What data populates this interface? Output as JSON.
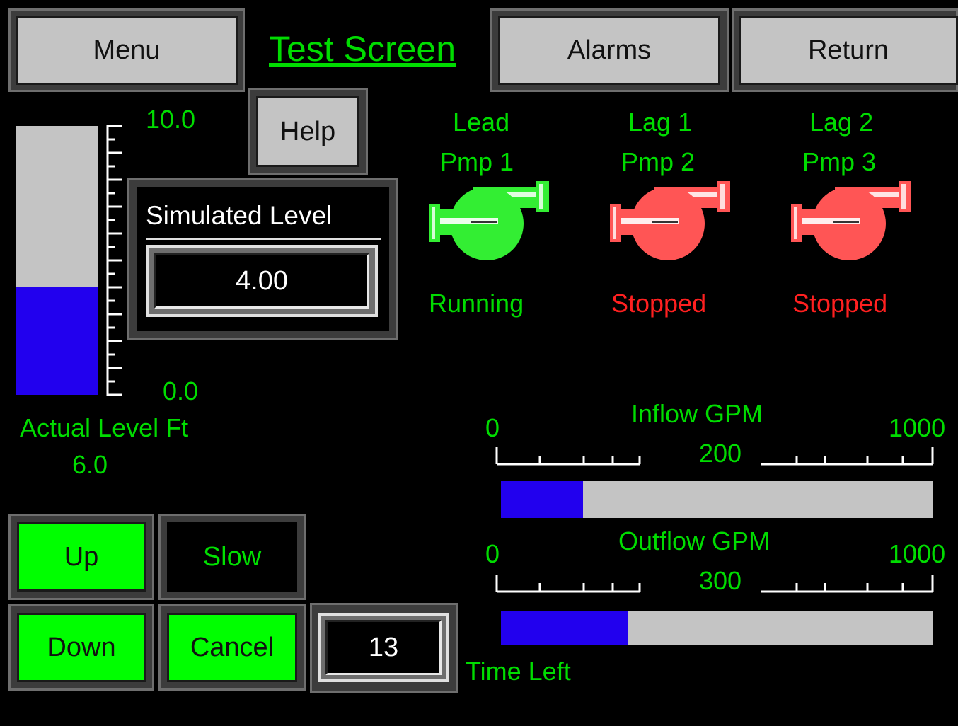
{
  "header": {
    "menu_label": "Menu",
    "title": "Test Screen",
    "alarms_label": "Alarms",
    "return_label": "Return"
  },
  "help_label": "Help",
  "level_gauge": {
    "max_label": "10.0",
    "min_label": "0.0",
    "caption": "Actual Level Ft",
    "value_text": "6.0",
    "fill_fraction": 0.4,
    "fill_color": "#2200ee",
    "empty_color": "#c4c4c4"
  },
  "simulated_level": {
    "label": "Simulated Level",
    "value": "4.00"
  },
  "pumps": [
    {
      "role": "Lead",
      "name": "Pmp 1",
      "status": "Running",
      "color": "#33ee33",
      "status_color": "#00dc00"
    },
    {
      "role": "Lag 1",
      "name": "Pmp 2",
      "status": "Stopped",
      "color": "#ff5555",
      "status_color": "#ff2020"
    },
    {
      "role": "Lag 2",
      "name": "Pmp 3",
      "status": "Stopped",
      "color": "#ff5555",
      "status_color": "#ff2020"
    }
  ],
  "inflow": {
    "label": "Inflow GPM",
    "min": "0",
    "max": "1000",
    "value": "200",
    "fraction": 0.19
  },
  "outflow": {
    "label": "Outflow GPM",
    "min": "0",
    "max": "1000",
    "value": "300",
    "fraction": 0.295
  },
  "controls": {
    "up_label": "Up",
    "slow_label": "Slow",
    "down_label": "Down",
    "cancel_label": "Cancel",
    "time_left_value": "13",
    "time_left_label": "Time Left"
  }
}
